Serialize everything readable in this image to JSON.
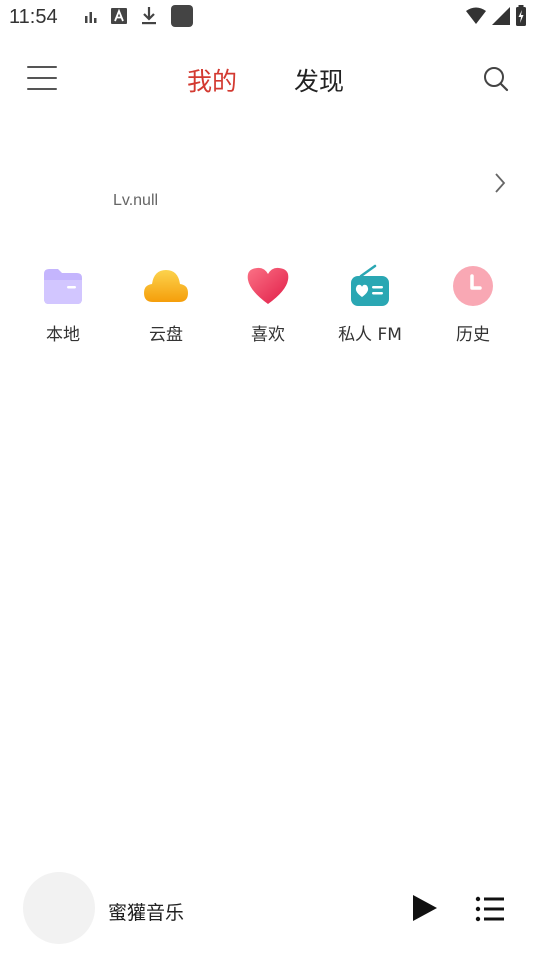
{
  "status_bar": {
    "time": "11:54",
    "icons": [
      "signal-bars-icon",
      "a-letter-icon",
      "download-icon",
      "app-square-icon",
      "wifi-icon",
      "cell-signal-icon",
      "battery-charging-icon"
    ]
  },
  "header": {
    "tabs": [
      {
        "label": "我的",
        "active": true
      },
      {
        "label": "发现",
        "active": false
      }
    ],
    "icons": [
      "menu-icon",
      "search-icon"
    ],
    "accent_color": "#d33a31"
  },
  "profile": {
    "level": "Lv.null"
  },
  "quick_access": [
    {
      "label": "本地",
      "icon": "folder-icon",
      "color": "#c4b5fd"
    },
    {
      "label": "云盘",
      "icon": "cloud-icon",
      "color": "#fbbf24"
    },
    {
      "label": "喜欢",
      "icon": "heart-icon",
      "color": "#f43f5e"
    },
    {
      "label": "私人 FM",
      "icon": "radio-icon",
      "color": "#2aa7b3"
    },
    {
      "label": "历史",
      "icon": "clock-icon",
      "color": "#f9a8b4"
    }
  ],
  "player": {
    "title": "蜜獾音乐",
    "icons": [
      "play-icon",
      "playlist-icon"
    ]
  }
}
